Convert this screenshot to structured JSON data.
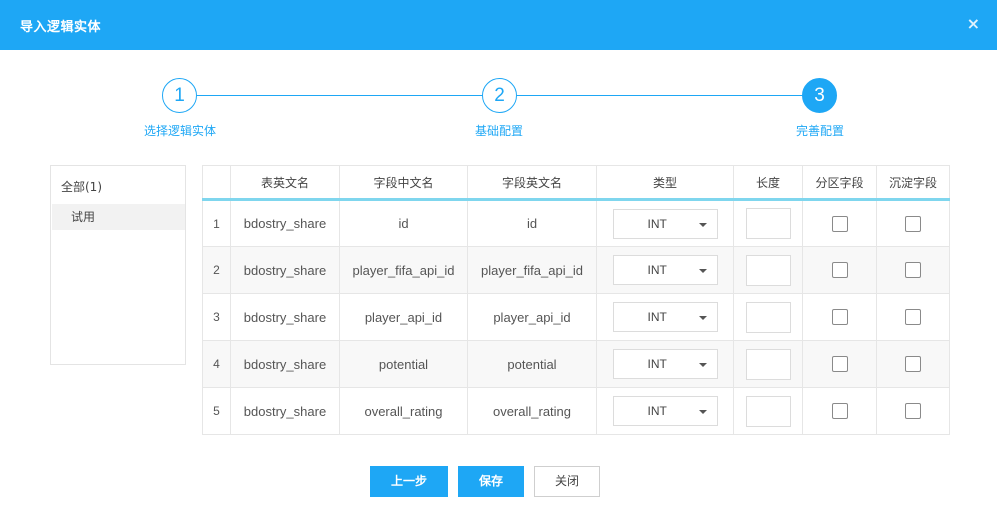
{
  "dialog": {
    "title": "导入逻辑实体",
    "close_glyph": "×"
  },
  "steps": [
    {
      "number": "1",
      "label": "选择逻辑实体",
      "active": false
    },
    {
      "number": "2",
      "label": "基础配置",
      "active": false
    },
    {
      "number": "3",
      "label": "完善配置",
      "active": true
    }
  ],
  "sidebar": {
    "all_label": "全部(1)",
    "items": [
      "试用"
    ]
  },
  "table": {
    "headers": [
      "",
      "表英文名",
      "字段中文名",
      "字段英文名",
      "类型",
      "长度",
      "分区字段",
      "沉淀字段"
    ],
    "rows": [
      {
        "index": "1",
        "table_name": "bdostry_share",
        "field_cn": "id",
        "field_en": "id",
        "type": "INT",
        "length": "",
        "partition": false,
        "sediment": false
      },
      {
        "index": "2",
        "table_name": "bdostry_share",
        "field_cn": "player_fifa_api_id",
        "field_en": "player_fifa_api_id",
        "type": "INT",
        "length": "",
        "partition": false,
        "sediment": false
      },
      {
        "index": "3",
        "table_name": "bdostry_share",
        "field_cn": "player_api_id",
        "field_en": "player_api_id",
        "type": "INT",
        "length": "",
        "partition": false,
        "sediment": false
      },
      {
        "index": "4",
        "table_name": "bdostry_share",
        "field_cn": "potential",
        "field_en": "potential",
        "type": "INT",
        "length": "",
        "partition": false,
        "sediment": false
      },
      {
        "index": "5",
        "table_name": "bdostry_share",
        "field_cn": "overall_rating",
        "field_en": "overall_rating",
        "type": "INT",
        "length": "",
        "partition": false,
        "sediment": false
      }
    ]
  },
  "footer": {
    "prev_label": "上一步",
    "save_label": "保存",
    "close_label": "关闭"
  },
  "colors": {
    "accent": "#1ea7f5",
    "header_underline": "#7fd6ee",
    "row_stripe": "#f8f8f8"
  }
}
